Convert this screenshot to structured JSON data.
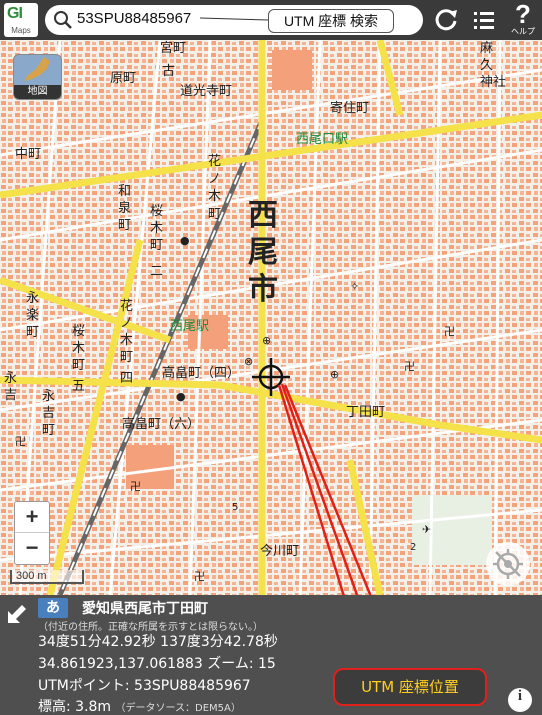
{
  "app": {
    "logo_text": "ԌI",
    "logo_sub": "Maps",
    "search_value": "53SPU88485967",
    "help_label": "ヘルプ"
  },
  "annotations": {
    "search_label": "UTM 座標 検索",
    "position_label": "UTM 座標位置"
  },
  "map": {
    "layer_button_label": "地図",
    "zoom_in": "+",
    "zoom_out": "−",
    "scale_label": "300 m",
    "city_label_1": "西",
    "city_label_2": "尾",
    "city_label_3": "市",
    "labels": {
      "miyamachi": "宮町",
      "harachi": "原町",
      "furu": "古",
      "doukoujimachi": "道光寺町",
      "nakamachi": "中町",
      "wa": "和",
      "izumi": "泉",
      "machi": "町",
      "hanano": "花",
      "no": "ノ",
      "ki": "木",
      "sakuragi": "桜",
      "nishioguchi": "西尾口駅",
      "nishio_eki": "西尾駅",
      "kouchou": "寄住町",
      "azabu": "麻",
      "hisa": "久",
      "jinja": "神社",
      "eiraku": "永",
      "raku": "楽",
      "ni": "二",
      "go": "五",
      "shi": "四",
      "ei": "永",
      "yoshi": "吉",
      "takahata_4": "高畠町（四）",
      "takahata_6": "高畠町（六）",
      "chouda": "丁田町",
      "imagawa": "今川町",
      "numbers_5": "5",
      "numbers_2": "2"
    }
  },
  "panel": {
    "badge": "あ",
    "address": "愛知県西尾市丁田町",
    "note": "（付近の住所。正確な所属を示すとは限らない。）",
    "dms": "34度51分42.92秒 137度3分42.78秒",
    "decimal": "34.861923,137.061883",
    "zoom_label": "ズーム: 15",
    "utm": "UTMポイント: 53SPU88485967",
    "elevation": "標高: 3.8m",
    "source": "（データソース：DEM5A）",
    "info": "i"
  },
  "colors": {
    "header": "#3a3a3a",
    "road_main": "#f5e24a",
    "road_minor": "#ffffff",
    "building": "#f3a27a",
    "annotation_red": "#e0201a"
  }
}
